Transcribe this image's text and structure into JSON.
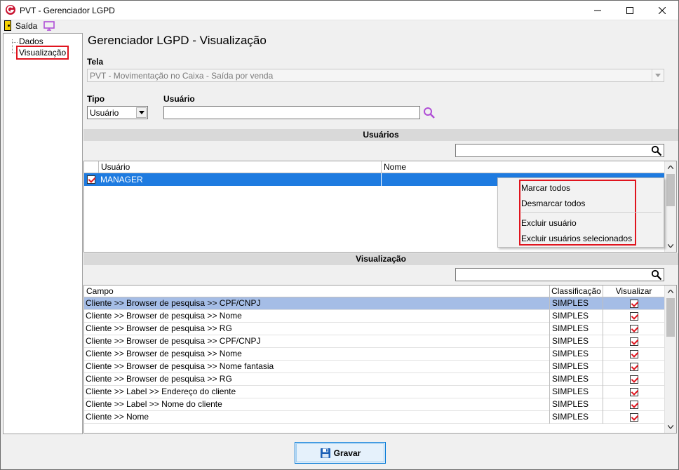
{
  "window": {
    "title": "PVT - Gerenciador LGPD"
  },
  "toolbar": {
    "exit_label": "Saída"
  },
  "tree": {
    "items": [
      {
        "label": "Dados"
      },
      {
        "label": "Visualização"
      }
    ]
  },
  "page": {
    "title": "Gerenciador LGPD - Visualização"
  },
  "form": {
    "tela_label": "Tela",
    "tela_value": "PVT - Movimentação no Caixa - Saída por venda",
    "tipo_label": "Tipo",
    "tipo_value": "Usuário",
    "usuario_label": "Usuário",
    "usuario_value": ""
  },
  "users_section": {
    "title": "Usuários",
    "filter_value": "",
    "columns": [
      "Usuário",
      "Nome"
    ],
    "rows": [
      {
        "checked": true,
        "usuario": "MANAGER",
        "nome": ""
      }
    ]
  },
  "context_menu": {
    "items": [
      "Marcar todos",
      "Desmarcar todos",
      "Excluir usuário",
      "Excluir usuários selecionados"
    ]
  },
  "view_section": {
    "title": "Visualização",
    "filter_value": "",
    "columns": [
      "Campo",
      "Classificação",
      "Visualizar"
    ],
    "rows": [
      {
        "campo": "Cliente  >> Browser de pesquisa >> CPF/CNPJ",
        "classificacao": "SIMPLES",
        "visualizar": true
      },
      {
        "campo": "Cliente  >> Browser de pesquisa >> Nome",
        "classificacao": "SIMPLES",
        "visualizar": true
      },
      {
        "campo": "Cliente  >> Browser de pesquisa >> RG",
        "classificacao": "SIMPLES",
        "visualizar": true
      },
      {
        "campo": "Cliente >> Browser de pesquisa >> CPF/CNPJ",
        "classificacao": "SIMPLES",
        "visualizar": true
      },
      {
        "campo": "Cliente >> Browser de pesquisa >> Nome",
        "classificacao": "SIMPLES",
        "visualizar": true
      },
      {
        "campo": "Cliente >> Browser de pesquisa >> Nome fantasia",
        "classificacao": "SIMPLES",
        "visualizar": true
      },
      {
        "campo": "Cliente >> Browser de pesquisa >> RG",
        "classificacao": "SIMPLES",
        "visualizar": true
      },
      {
        "campo": "Cliente >> Label >> Endereço do cliente",
        "classificacao": "SIMPLES",
        "visualizar": true
      },
      {
        "campo": "Cliente >> Label >> Nome do cliente",
        "classificacao": "SIMPLES",
        "visualizar": true
      },
      {
        "campo": "Cliente >> Nome",
        "classificacao": "SIMPLES",
        "visualizar": true
      }
    ]
  },
  "actions": {
    "save_label": "Gravar"
  },
  "colors": {
    "selection_blue": "#1e7be0",
    "row_selected": "#a5bde6",
    "highlight_red": "#e0141e",
    "accent_purple": "#b04fd6"
  }
}
